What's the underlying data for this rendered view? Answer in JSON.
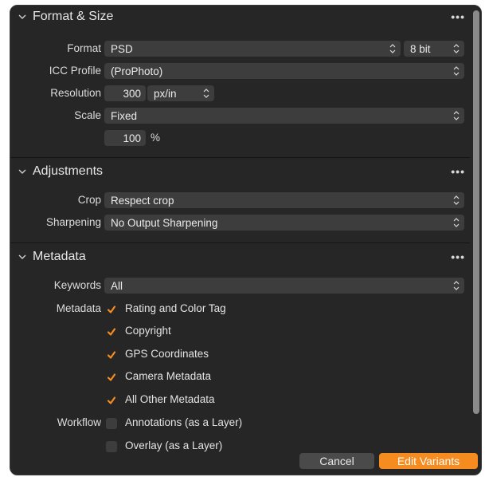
{
  "sections": {
    "format": {
      "title": "Format & Size",
      "menu_icon": "more-icon",
      "format_label": "Format",
      "format_value": "PSD",
      "bitdepth_value": "8 bit",
      "icc_label": "ICC Profile",
      "icc_value": "(ProPhoto)",
      "resolution_label": "Resolution",
      "resolution_value": "300",
      "resolution_unit": "px/in",
      "scale_label": "Scale",
      "scale_value": "Fixed",
      "scale_percent": "100",
      "scale_percent_unit": "%"
    },
    "adjustments": {
      "title": "Adjustments",
      "crop_label": "Crop",
      "crop_value": "Respect crop",
      "sharpening_label": "Sharpening",
      "sharpening_value": "No Output Sharpening"
    },
    "metadata": {
      "title": "Metadata",
      "keywords_label": "Keywords",
      "keywords_value": "All",
      "metadata_label": "Metadata",
      "items": [
        {
          "label": "Rating and Color Tag",
          "checked": true
        },
        {
          "label": "Copyright",
          "checked": true
        },
        {
          "label": "GPS Coordinates",
          "checked": true
        },
        {
          "label": "Camera Metadata",
          "checked": true
        },
        {
          "label": "All Other Metadata",
          "checked": true
        }
      ],
      "workflow_label": "Workflow",
      "workflow_items": [
        {
          "label": "Annotations (as a Layer)",
          "checked": false
        },
        {
          "label": "Overlay (as a Layer)",
          "checked": false
        }
      ]
    }
  },
  "footer": {
    "cancel_label": "Cancel",
    "primary_label": "Edit Variants"
  },
  "colors": {
    "panel_bg": "#262626",
    "control_bg": "#3d3d3d",
    "accent": "#f68b1f"
  }
}
